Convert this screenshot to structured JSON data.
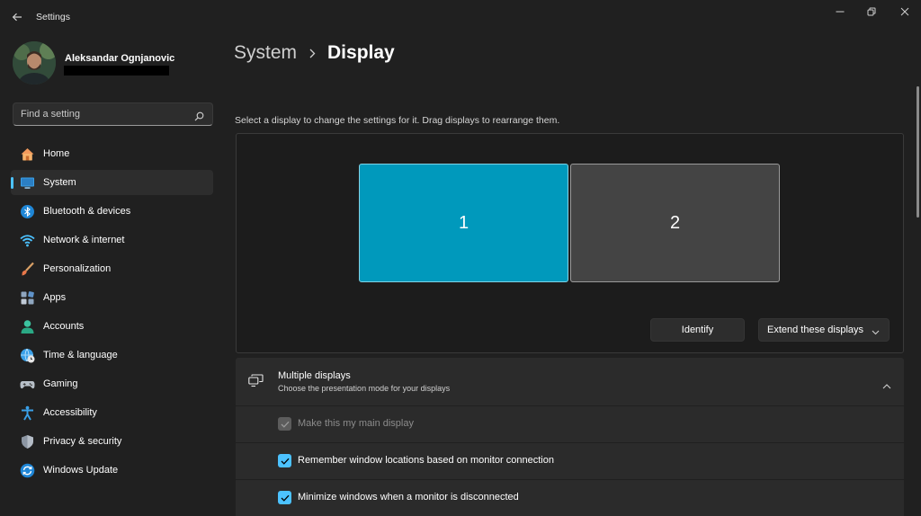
{
  "window": {
    "title": "Settings"
  },
  "user": {
    "name": "Aleksandar Ognjanovic"
  },
  "search": {
    "placeholder": "Find a setting"
  },
  "nav": {
    "items": [
      {
        "label": "Home",
        "icon": "home-icon"
      },
      {
        "label": "System",
        "icon": "system-icon",
        "active": true
      },
      {
        "label": "Bluetooth & devices",
        "icon": "bluetooth-icon"
      },
      {
        "label": "Network & internet",
        "icon": "wifi-icon"
      },
      {
        "label": "Personalization",
        "icon": "paintbrush-icon"
      },
      {
        "label": "Apps",
        "icon": "apps-icon"
      },
      {
        "label": "Accounts",
        "icon": "accounts-icon"
      },
      {
        "label": "Time & language",
        "icon": "globe-clock-icon"
      },
      {
        "label": "Gaming",
        "icon": "gamepad-icon"
      },
      {
        "label": "Accessibility",
        "icon": "accessibility-icon"
      },
      {
        "label": "Privacy & security",
        "icon": "shield-icon"
      },
      {
        "label": "Windows Update",
        "icon": "update-icon"
      }
    ]
  },
  "breadcrumb": {
    "parent": "System",
    "current": "Display"
  },
  "display": {
    "instruction": "Select a display to change the settings for it. Drag displays to rearrange them.",
    "monitors": [
      {
        "label": "1",
        "selected": true
      },
      {
        "label": "2",
        "selected": false
      }
    ],
    "identify_label": "Identify",
    "mode_value": "Extend these displays"
  },
  "multiple_displays": {
    "title": "Multiple displays",
    "subtitle": "Choose the presentation mode for your displays",
    "expanded": true,
    "options": [
      {
        "label": "Make this my main display",
        "checked": true,
        "disabled": true
      },
      {
        "label": "Remember window locations based on monitor connection",
        "checked": true,
        "disabled": false
      },
      {
        "label": "Minimize windows when a monitor is disconnected",
        "checked": true,
        "disabled": false
      }
    ]
  },
  "colors": {
    "accent": "#4cc2ff",
    "selected_monitor": "#0099bc",
    "background": "#202020",
    "card": "#2b2b2b"
  }
}
